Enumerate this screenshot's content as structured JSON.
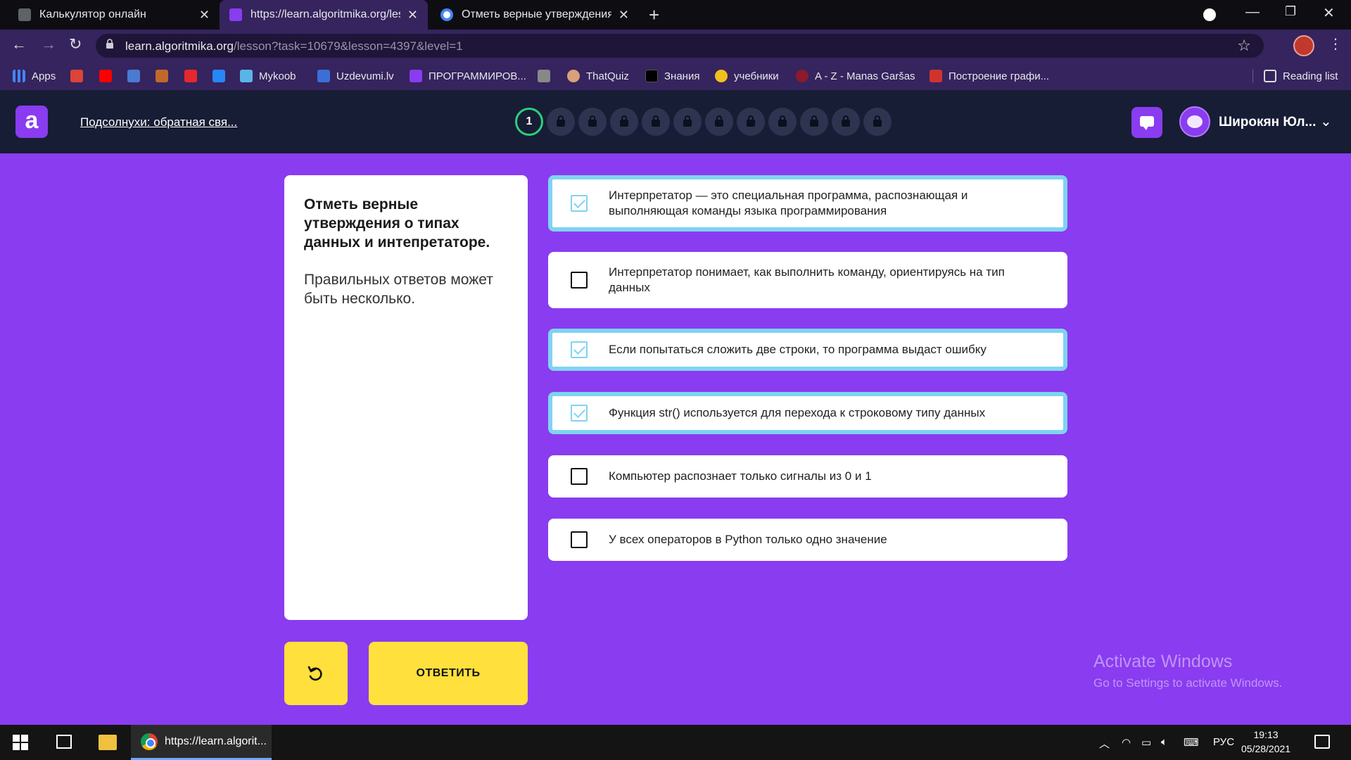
{
  "browser": {
    "tabs": [
      {
        "title": "Калькулятор онлайн",
        "favicon_color": "#5f6368"
      },
      {
        "title": "https://learn.algoritmika.org/less",
        "favicon_color": "#8a3cf0"
      },
      {
        "title": "Отметь верные утверждения о",
        "favicon_color": "#4285f4"
      }
    ],
    "url_host": "learn.algoritmika.org",
    "url_path": "/lesson?task=10679&lesson=4397&level=1",
    "bookmarks": [
      {
        "label": "Apps",
        "color": "#4285f4"
      },
      {
        "label": "",
        "color": "#db4437"
      },
      {
        "label": "",
        "color": "#ff0000"
      },
      {
        "label": "",
        "color": "#4a7bd1"
      },
      {
        "label": "",
        "color": "#c0692b"
      },
      {
        "label": "",
        "color": "#e5282e"
      },
      {
        "label": "",
        "color": "#2787f5"
      },
      {
        "label": "Mykoob",
        "color": "#5ab4e8"
      },
      {
        "label": "Uzdevumi.lv",
        "color": "#3b6fd6"
      },
      {
        "label": "ПРОГРАММИРОВ...",
        "color": "#8a3cf0"
      },
      {
        "label": "",
        "color": "#888888"
      },
      {
        "label": "ThatQuiz",
        "color": "#d9a17a"
      },
      {
        "label": "Знания",
        "color": "#000000"
      },
      {
        "label": "учебники",
        "color": "#f0c020"
      },
      {
        "label": "A - Z - Manas Garšas",
        "color": "#8b1a2a"
      },
      {
        "label": "Построение графи...",
        "color": "#d0332e"
      }
    ],
    "reading_list": "Reading list"
  },
  "app": {
    "logo": "a",
    "lesson_title": "Подсолнухи: обратная свя...",
    "current_step": "1",
    "total_steps": 12,
    "username": "Широкян Юл...",
    "accent": "#8a3cf0"
  },
  "question": {
    "title": "Отметь верные утверждения о типах данных и интепретаторе.",
    "hint": "Правильных ответов может быть несколько."
  },
  "options": [
    {
      "text": "Интерпретатор — это специальная программа, распознающая и выполняющая команды языка программирования",
      "checked": true
    },
    {
      "text": "Интерпретатор понимает, как выполнить команду, ориентируясь на тип данных",
      "checked": false
    },
    {
      "text": "Если попытаться сложить две строки, то программа выдаст ошибку",
      "checked": true
    },
    {
      "text": "Функция str() используется для перехода к строковому типу данных",
      "checked": true
    },
    {
      "text": "Компьютер распознает только сигналы из 0 и 1",
      "checked": false
    },
    {
      "text": "У всех операторов в Python только одно значение",
      "checked": false
    }
  ],
  "actions": {
    "reset_icon": "undo-icon",
    "answer_label": "ОТВЕТИТЬ"
  },
  "watermark": {
    "title": "Activate Windows",
    "subtitle": "Go to Settings to activate Windows."
  },
  "taskbar": {
    "chrome_label": "https://learn.algorit...",
    "lang": "РУС",
    "time": "19:13",
    "date": "05/28/2021"
  }
}
